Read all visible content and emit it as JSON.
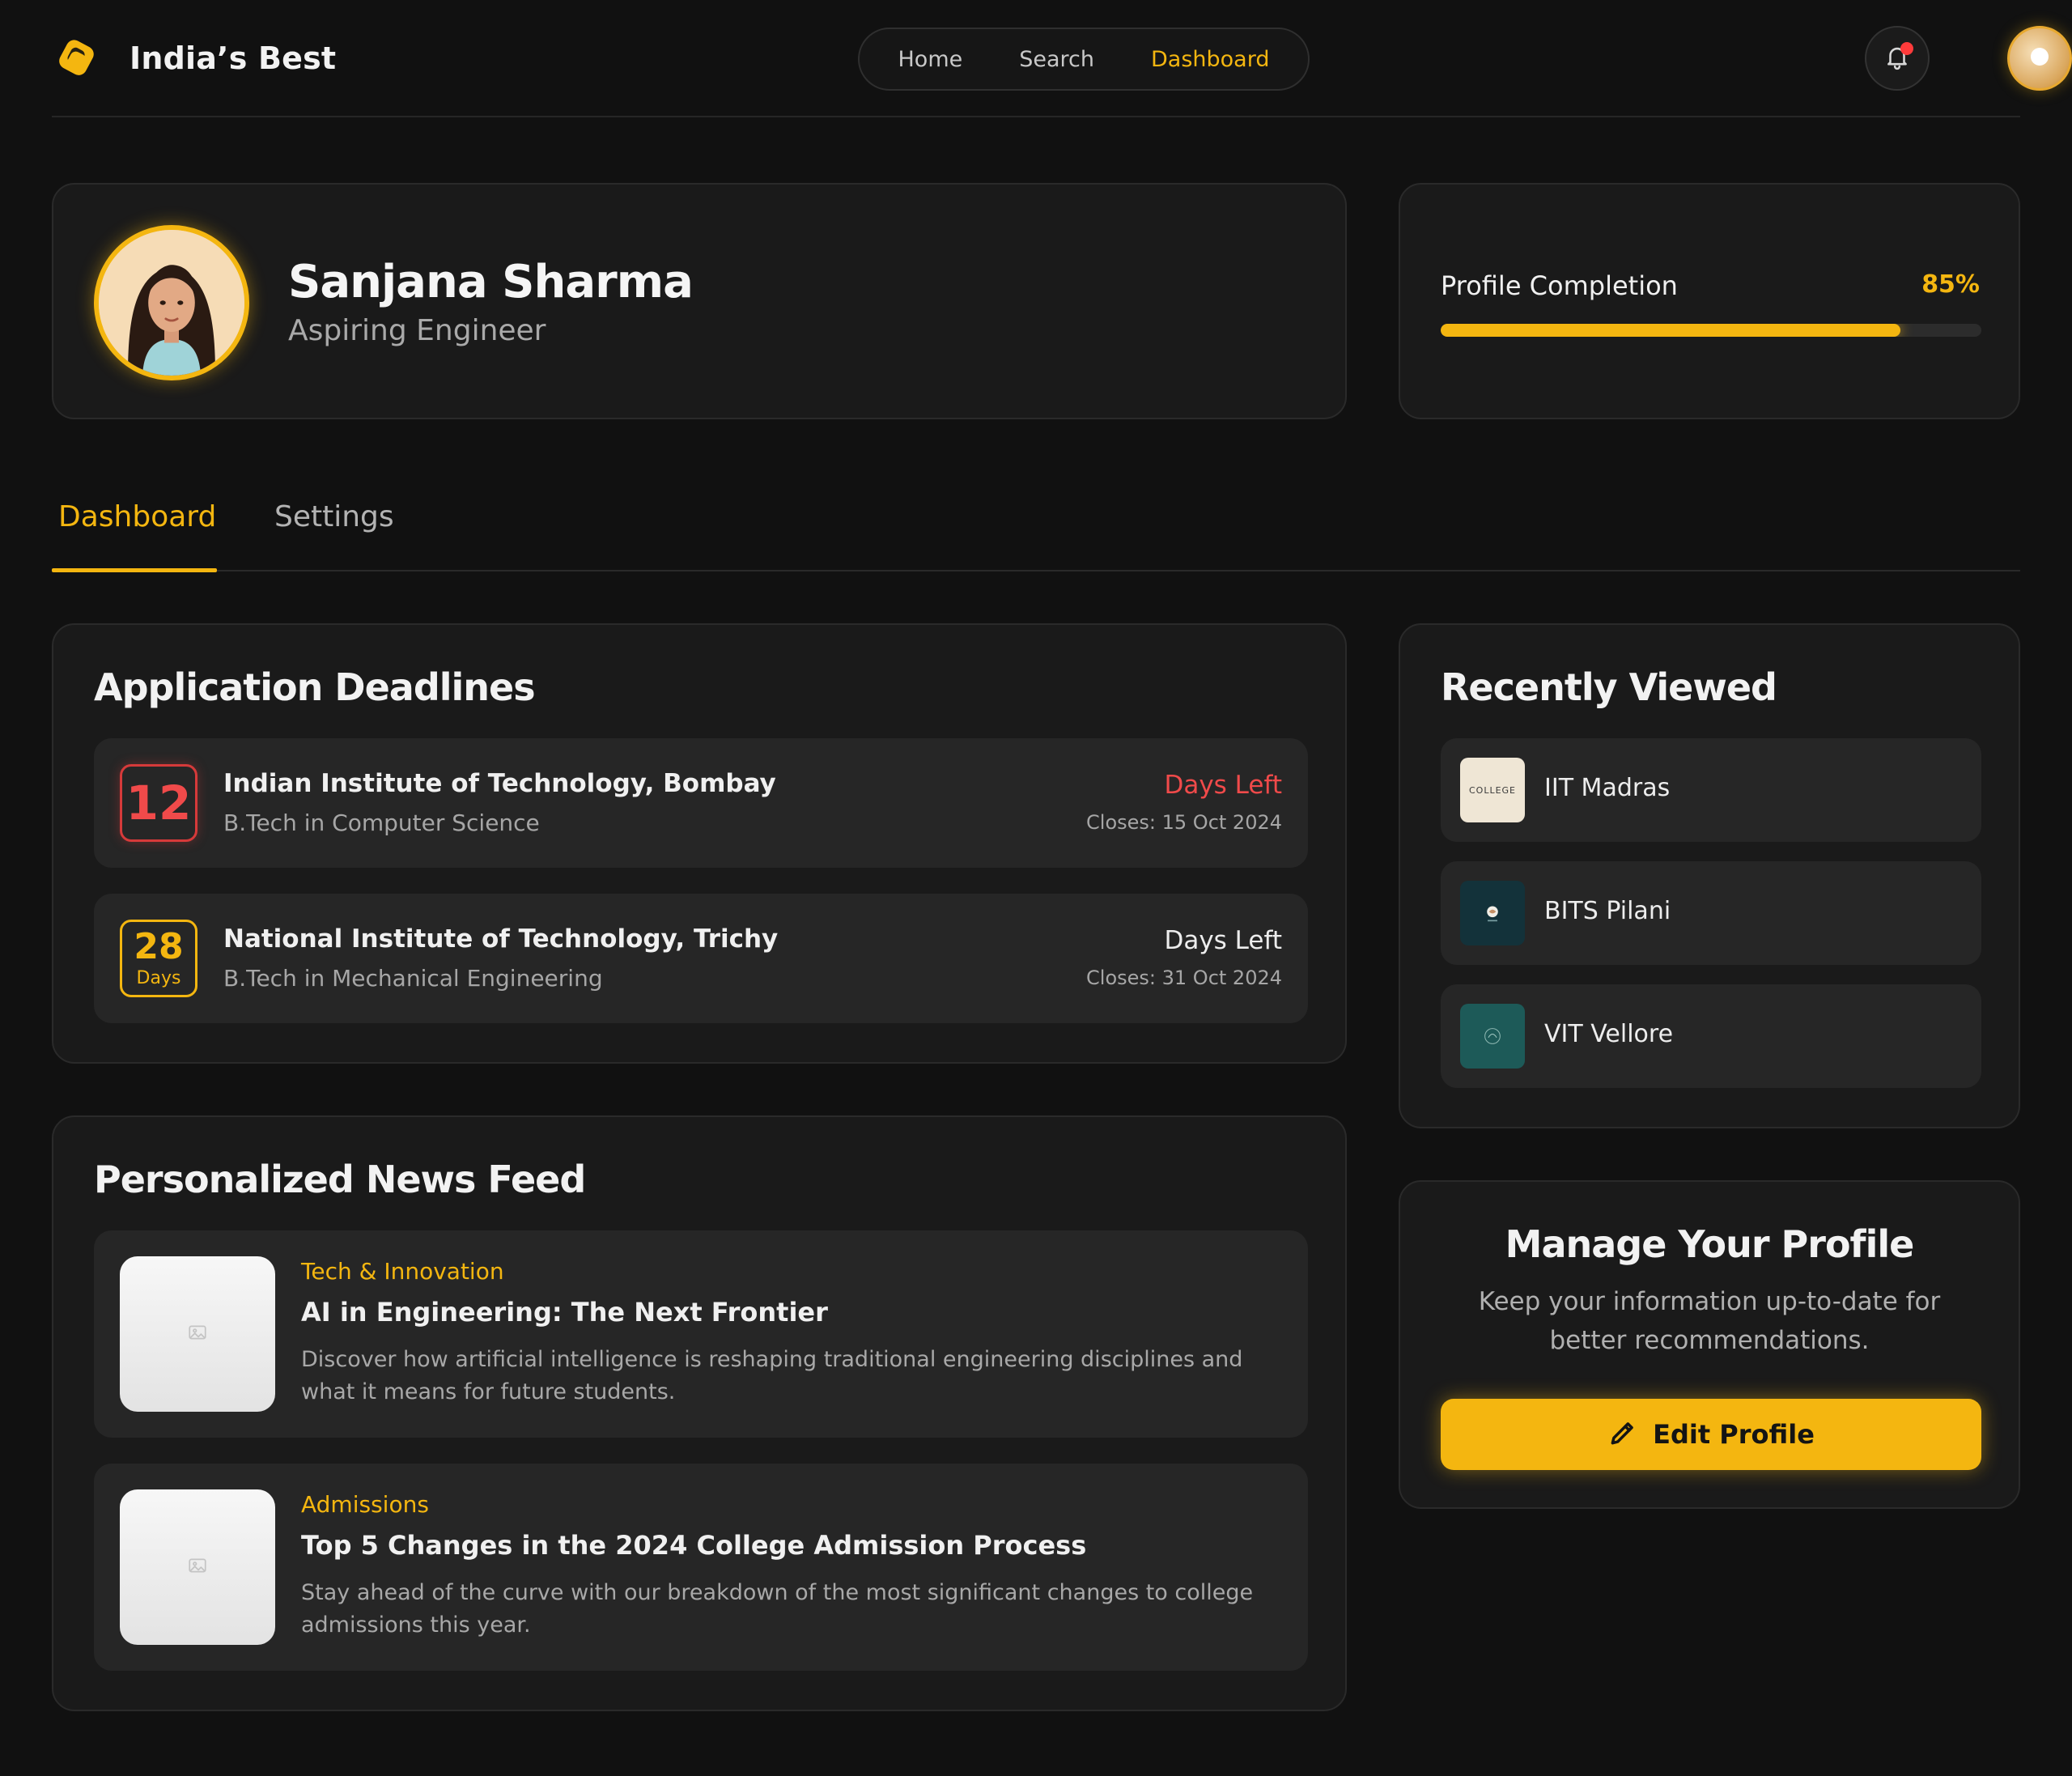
{
  "brand": {
    "name": "India’s Best"
  },
  "nav": {
    "links": [
      "Home",
      "Search",
      "Dashboard"
    ],
    "active": "Dashboard"
  },
  "notifications": {
    "has_unread": true
  },
  "profile": {
    "name": "Sanjana Sharma",
    "role": "Aspiring Engineer"
  },
  "completion": {
    "label": "Profile Completion",
    "percent_text": "85%",
    "percent": 85
  },
  "tabs": {
    "items": [
      "Dashboard",
      "Settings"
    ],
    "active": "Dashboard"
  },
  "deadlines": {
    "title": "Application Deadlines",
    "items": [
      {
        "days": "12",
        "unit": "",
        "institute": "Indian Institute of Technology, Bombay",
        "course": "B.Tech in Computer Science",
        "left_label": "Days Left",
        "closes": "Closes: 15 Oct 2024",
        "urgency": "high"
      },
      {
        "days": "28",
        "unit": "Days",
        "institute": "National Institute of Technology, Trichy",
        "course": "B.Tech in Mechanical Engineering",
        "left_label": "Days Left",
        "closes": "Closes: 31 Oct 2024",
        "urgency": "normal"
      }
    ]
  },
  "news": {
    "title": "Personalized News Feed",
    "items": [
      {
        "category": "Tech & Innovation",
        "headline": "AI in Engineering: The Next Frontier",
        "summary": "Discover how artificial intelligence is reshaping traditional engineering disciplines and what it means for future students."
      },
      {
        "category": "Admissions",
        "headline": "Top 5 Changes in the 2024 College Admission Process",
        "summary": "Stay ahead of the curve with our breakdown of the most significant changes to college admissions this year."
      }
    ]
  },
  "recent": {
    "title": "Recently Viewed",
    "items": [
      {
        "name": "IIT Madras",
        "logo_text": "COLLEGE"
      },
      {
        "name": "BITS Pilani",
        "logo_text": ""
      },
      {
        "name": "VIT Vellore",
        "logo_text": ""
      }
    ]
  },
  "manage": {
    "title": "Manage Your Profile",
    "description": "Keep your information up-to-date for better recommendations.",
    "button_label": "Edit Profile"
  },
  "colors": {
    "accent": "#f4b610",
    "urgent": "#f04a4a",
    "background": "#111111",
    "card": "#1a1a1a"
  }
}
